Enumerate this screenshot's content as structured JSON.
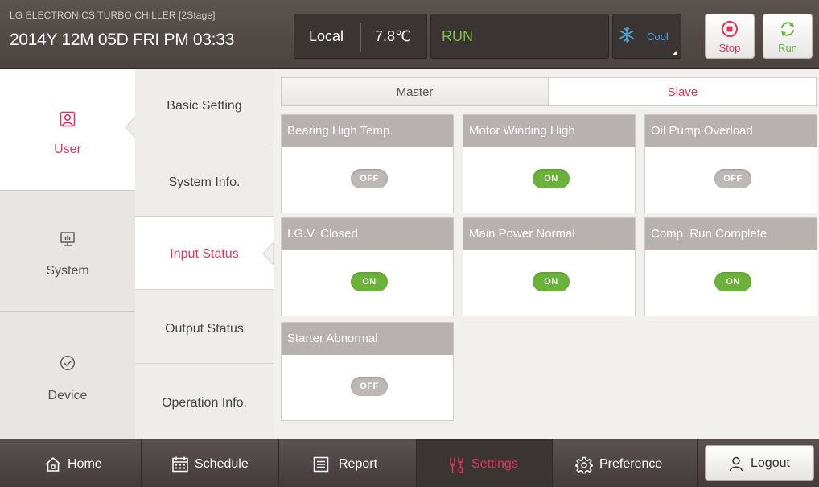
{
  "header": {
    "brand": "LG ELECTRONICS TURBO CHILLER [2Stage]",
    "datetime": "2014Y 12M 05D  FRI PM 03:33",
    "control_location": "Local",
    "temperature": "7.8℃",
    "run_status": "RUN",
    "mode": "Cool",
    "stop_label": "Stop",
    "run_label": "Run"
  },
  "colors": {
    "accent_red": "#e0345c",
    "on_green": "#6ab23a",
    "off_gray": "#bdb8b6",
    "run_green": "#7fc34a",
    "cool_blue": "#4aa8e0"
  },
  "left_nav": {
    "items": [
      {
        "label": "User",
        "icon": "user-icon",
        "active": true
      },
      {
        "label": "System",
        "icon": "monitor-icon",
        "active": false
      },
      {
        "label": "Device",
        "icon": "check-circle-icon",
        "active": false
      }
    ]
  },
  "sub_nav": {
    "items": [
      {
        "label": "Basic Setting",
        "active": false
      },
      {
        "label": "System Info.",
        "active": false
      },
      {
        "label": "Input Status",
        "active": true
      },
      {
        "label": "Output Status",
        "active": false
      },
      {
        "label": "Operation Info.",
        "active": false
      }
    ]
  },
  "tabs": {
    "master": "Master",
    "slave": "Slave",
    "selected": "Slave"
  },
  "inputs": [
    {
      "title": "Bearing High Temp.",
      "state": "OFF"
    },
    {
      "title": "Motor Winding High",
      "state": "ON"
    },
    {
      "title": "Oil Pump Overload",
      "state": "OFF"
    },
    {
      "title": "I.G.V. Closed",
      "state": "ON"
    },
    {
      "title": "Main Power Normal",
      "state": "ON"
    },
    {
      "title": "Comp. Run Complete",
      "state": "ON"
    },
    {
      "title": "Starter Abnormal",
      "state": "OFF"
    }
  ],
  "bottom_nav": {
    "home": "Home",
    "schedule": "Schedule",
    "report": "Report",
    "settings": "Settings",
    "preference": "Preference",
    "logout": "Logout",
    "active": "Settings"
  }
}
